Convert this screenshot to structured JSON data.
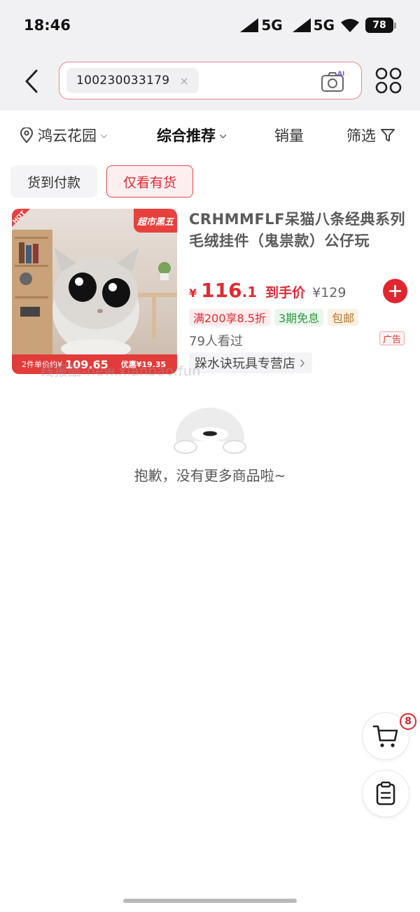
{
  "status_bar": {
    "time": "18:46",
    "signal1": "5G",
    "signal2": "5G",
    "battery": "78"
  },
  "search": {
    "query": "100230033179",
    "clear_icon": "×",
    "camera_badge": "AI"
  },
  "filters": {
    "location": "鸿云花园",
    "sort": "综合推荐",
    "sales": "销量",
    "filter": "筛选"
  },
  "quick_tags": {
    "cod": "货到付款",
    "in_stock": "仅看有货"
  },
  "product": {
    "title": "CRHMMFLF呆猫八条经典系列毛绒挂件（鬼祟款）公仔玩",
    "price_currency": "¥",
    "price_int": "116",
    "price_dec": ".1",
    "price_label": "到手价",
    "original_price": "¥129",
    "badges": [
      "满200享8.5折",
      "3期免息",
      "包邮"
    ],
    "viewed": "79人看过",
    "ad_label": "广告",
    "store": "跺水诀玩具专营店",
    "image": {
      "hot": "HOT",
      "tag": "超市黑五",
      "promo_label": "2件单价约¥",
      "promo_price": "109.65",
      "promo_discount": "优惠¥19.35"
    }
  },
  "watermark": "线报酷-new.xianbao.fun",
  "empty_state": {
    "text": "抱歉，没有更多商品啦~"
  },
  "floating": {
    "cart_count": "8"
  },
  "colors": {
    "accent_red": "#e02a32",
    "top_bg": "#f1f1f3"
  }
}
